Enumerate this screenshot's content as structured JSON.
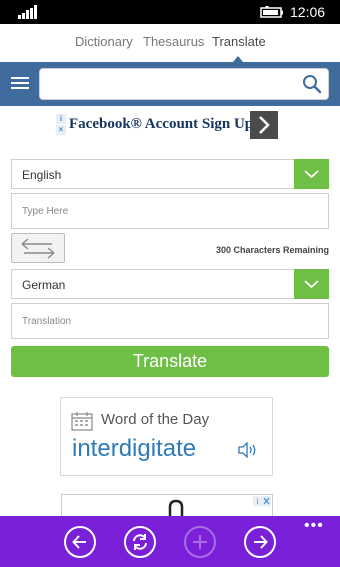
{
  "status_bar": {
    "time": "12:06"
  },
  "pivot": {
    "tabs": [
      "Dictionary",
      "Thesaurus",
      "Translate"
    ],
    "active": "Translate"
  },
  "search": {
    "value": "",
    "placeholder": ""
  },
  "ad": {
    "text": "Facebook® Account Sign Up"
  },
  "translate": {
    "source_language": "English",
    "source_placeholder": "Type Here",
    "characters_remaining": "300 Characters Remaining",
    "target_language": "German",
    "output_placeholder": "Translation",
    "button_label": "Translate"
  },
  "word_of_day": {
    "title": "Word of the Day",
    "word": "interdigitate"
  },
  "app_bar": {
    "buttons": [
      "back-icon",
      "refresh-icon",
      "add-icon",
      "forward-icon"
    ],
    "more": "•••"
  },
  "colors": {
    "header": "#3f6c9c",
    "accent_green": "#6fbe45",
    "app_bar": "#7a20d9",
    "link_blue": "#2f7ab8"
  }
}
